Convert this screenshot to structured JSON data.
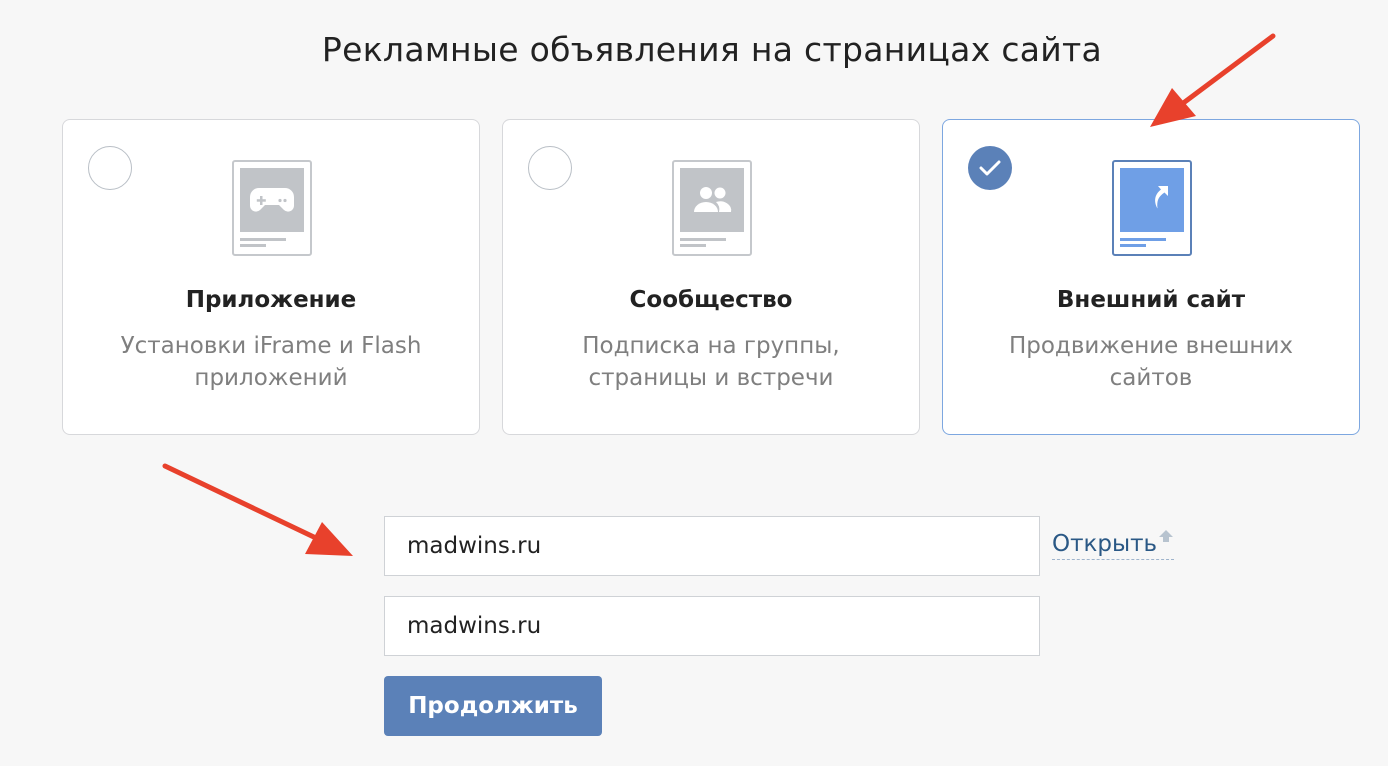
{
  "title": "Рекламные объявления на страницах сайта",
  "options": [
    {
      "title": "Приложение",
      "description": "Установки iFrame и Flash приложений",
      "icon": "gamepad-icon",
      "selected": false
    },
    {
      "title": "Сообщество",
      "description": "Подписка на группы, страницы и встречи",
      "icon": "community-icon",
      "selected": false
    },
    {
      "title": "Внешний сайт",
      "description": "Продвижение внешних сайтов",
      "icon": "external-link-icon",
      "selected": true
    }
  ],
  "form": {
    "url_value": "madwins.ru",
    "name_value": "madwins.ru",
    "open_link_label": "Открыть",
    "continue_label": "Продолжить"
  },
  "colors": {
    "accent": "#5b81b8",
    "selected_border": "#7da7e0",
    "link": "#2a5885",
    "annotation_arrow": "#e8412c"
  }
}
